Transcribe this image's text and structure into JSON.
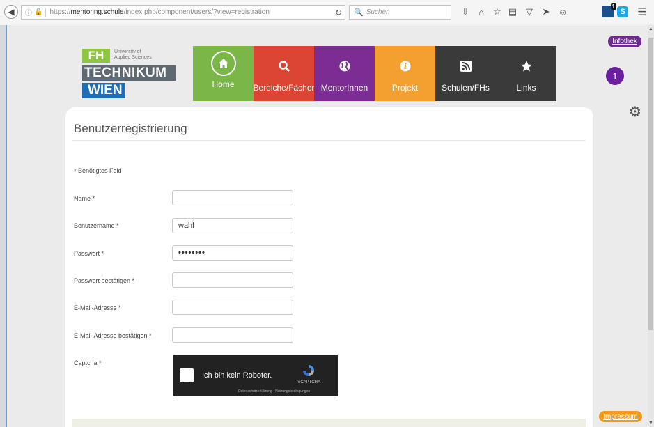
{
  "browser": {
    "url_prefix": "https://",
    "url_host": "mentoring.schule",
    "url_rest": "/index.php/component/users/?view=registration",
    "search_placeholder": "Suchen",
    "ext_badge_count": "1"
  },
  "site": {
    "logo": {
      "fh": "FH",
      "university_line1": "University of",
      "university_line2": "Applied Sciences",
      "technikum": "TECHNIKUM",
      "wien": "WIEN"
    },
    "nav": [
      {
        "label": "Home",
        "color": "#7ab648",
        "icon": "home-icon"
      },
      {
        "label": "Bereiche/Fächer",
        "color": "#dc4433",
        "icon": "search-icon"
      },
      {
        "label": "MentorInnen",
        "color": "#7b2d93",
        "icon": "globe-icon"
      },
      {
        "label": "Projekt",
        "color": "#f4a031",
        "icon": "info-icon"
      },
      {
        "label": "Schulen/FHs",
        "color": "#3a3a3a",
        "icon": "rss-icon"
      },
      {
        "label": "Links",
        "color": "#3a3a3a",
        "icon": "star-icon"
      }
    ],
    "infothek": "Infothek",
    "notification_count": "1",
    "impressum": "Impressum"
  },
  "form": {
    "title": "Benutzerregistrierung",
    "required_note": "* Benötigtes Feld",
    "fields": [
      {
        "label": "Name *",
        "value": ""
      },
      {
        "label": "Benutzername *",
        "value": "wahl"
      },
      {
        "label": "Passwort *",
        "value": "••••••••"
      },
      {
        "label": "Passwort bestätigen *",
        "value": ""
      },
      {
        "label": "E-Mail-Adresse *",
        "value": ""
      },
      {
        "label": "E-Mail-Adresse bestätigen *",
        "value": ""
      }
    ],
    "captcha_label": "Captcha *",
    "captcha": {
      "text": "Ich bin kein Roboter.",
      "brand": "reCAPTCHA",
      "terms": "Datenschutzerklärung - Nutzungsbedingungen"
    }
  }
}
